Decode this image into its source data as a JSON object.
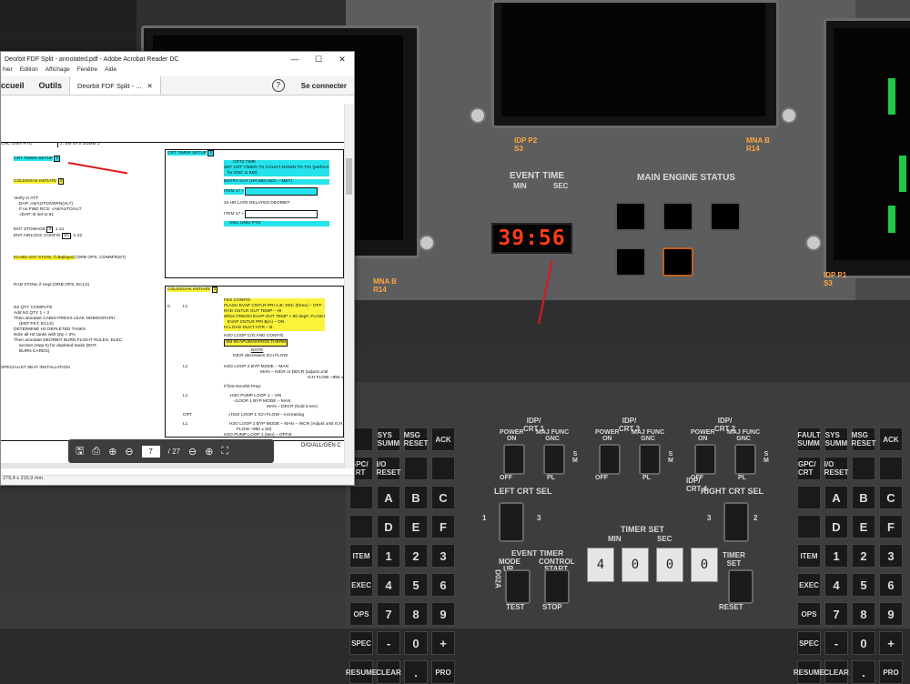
{
  "window": {
    "title": "Deorbit FDF Split - annotated.pdf - Adobe Acrobat Reader DC",
    "minimize": "—",
    "maximize": "☐",
    "close": "✕"
  },
  "menu": [
    "hier",
    "Edition",
    "Affichage",
    "Fenêtre",
    "Aide"
  ],
  "toolbar": {
    "home": "ccueil",
    "tools": "Outils",
    "tab_label": "Deorbit FDF Split - ...",
    "tab_close": "✕",
    "help": "?",
    "signin": "Se connecter"
  },
  "doc": {
    "header_left": "GNC UNIV PTG",
    "header_mid": "2: SM SYS SUMM 1",
    "crt_timer_left": "CRT TIMER SETUP",
    "crt_timer_left_num": "1",
    "coldsoak_left": "COLDSOAK INITIATE",
    "coldsoak_left_num": "2",
    "verify_lines": [
      "Verify in ATT:",
      "DAP: A5/AUTO/VERN(ALT)",
      "If no FWD RCS: √A6/AUTO/ALT",
      "√DAP: B set to 81"
    ],
    "ent_stowage": "ENT STOWAGE",
    "ent_stowage_num": "3",
    "ent_stowage_ref": ", 1-31",
    "ent_airlock": "ENT AIRLOCK CONFIG",
    "ent_airlock_num": "3A",
    "ent_airlock_ref": ", 1-32",
    "kuband": "KU-BD ANT STOW, if deployed",
    "kuband_ref": "(ORB OPS, COMM/INST)",
    "rad_stow": "RAD STOW, if reqd (ORB OPS, ECLS)",
    "n2_lines": [
      "N2 QTY COMPUTE",
      "Add N2 QTY 1 + 2",
      "Then annotate CABIN PRESS LEAK NOMOGRAPH",
      "(ENT PKT, ECLS)",
      "DETERMINE H2 DEPLETED TANKS",
      "Note all H2 tanks with Qty < 3%",
      "Then annotate DEORBIT BURN FLIGHT RULES, ELEC",
      "section (step 6) for depleted tanks (ENT,",
      "BURN CARDS)"
    ],
    "specialist": "SPECIALIST SEAT INSTALLATION",
    "crt_timer_right": "CRT TIMER SETUP",
    "crt_timer_right_num": "1",
    "crt_right_lines": [
      "CRT2 TIME",
      "SET CRT TIMER TO COUNT DOWN TO TIG (perform",
      "for GNC & SM):",
      "ENTRY DAY (HR MIN SEC – MET)",
      "ITEM 17 +",
      "24 HR LATE DELAYED DEORBIT",
      "ITEM 17 +",
      "GNC UNIV PTG"
    ],
    "coldsoak_right": "COLDSOAK INITIATE",
    "coldsoak_right_num": "2",
    "fes_c": "C",
    "fes_l1": "L1",
    "fes_lines": [
      "FES CONFIG",
      "FLASH EVAP CNTLR PRI A,B; SEC (three) – OFF",
      "RAD CNTLR OUT TEMP – HI",
      "When FREON EVAP OUT TEMP > 50 degF, FLASH",
      "EVAP CNTLR PRI B(A) – ON",
      "HI LOAD DUCT HTR – B"
    ],
    "h2o_lines": [
      "H2O LOOP C/O AND CONFIG",
      "SM 88 APU/ENVIRON THERM",
      "NOTE",
      "INCR decreases ICH FLOW"
    ],
    "l1_a": "L1",
    "h2o_byp": [
      "H2O LOOP 2 BYP MODE – MAN",
      "MAN   – INCR or DECR (adjust until",
      "ICH FLOW ~950 ± 50)"
    ],
    "if_first": "If first Deorbit Prep:",
    "l1_b": "L1",
    "pump_lines": [
      "H2O PUMP LOOP 1 – ON",
      "√LOOP 1 BYP MODE – MAN",
      "MAN   – DECR (hold 5 sec)"
    ],
    "crt_label": "CRT",
    "ich_line": "√H2O LOOP 1 ICH FLOW – increasing",
    "l1_c": "L1",
    "final_lines": [
      "H2O LOOP 1 BYP MODE – MAN – INCR (Adjust until ICH",
      "FLOW ~950 ± 50)",
      "H2O PUMP LOOP 1 (two) – OFF,B"
    ],
    "page_num": "1-7",
    "footer_code": "D/O/ALL/GEN C"
  },
  "nav": {
    "current_page": "7",
    "total": "/ 27"
  },
  "status": {
    "size": "279,4 x 215,9 mm"
  },
  "cockpit": {
    "event_time": "EVENT TIME",
    "min": "MIN",
    "sec": "SEC",
    "timer_readout": "39:56",
    "main_engine": "MAIN ENGINE STATUS",
    "idp3": "IDP P2\nS3",
    "idp1": "IDP P1\nS3",
    "mnab_left": "MNA B\nR14",
    "mnab_right": "MNA B\nR14",
    "crt_on": "ON",
    "crt_switches": [
      {
        "title": "IDP/\nCRT 1",
        "power": "POWER\nON",
        "maj": "MAJ FUNC\nGNC",
        "s": "S\nM",
        "off": "OFF",
        "pl": "PL"
      },
      {
        "title": "IDP/\nCRT 3",
        "power": "POWER\nON",
        "maj": "MAJ FUNC\nGNC",
        "s": "S\nM",
        "off": "OFF",
        "pl": "PL"
      },
      {
        "title": "IDP/\nCRT 2",
        "power": "POWER\nON",
        "maj": "MAJ FUNC\nGNC",
        "s": "S\nM",
        "off": "OFF",
        "pl": "PL"
      }
    ],
    "left_crt_sel": "LEFT CRT SEL",
    "right_crt_sel": "RIGHT CRT SEL",
    "idp_label": "IDP/\nCRT 4",
    "timer_set": "TIMER SET",
    "timer_min": "MIN",
    "timer_sec": "SEC",
    "thumbwheels": [
      "4",
      "0",
      "0",
      "0"
    ],
    "event_timer": "EVENT TIMER",
    "mode": "MODE",
    "up": "UP",
    "control": "CONTROL",
    "start": "START",
    "test": "TEST",
    "stop": "STOP",
    "timer_right": "TIMER\nSET",
    "reset": "RESET",
    "d02a": "D02A",
    "label_1": "1",
    "label_3": "3",
    "label_2": "2",
    "keypad_left": [
      "",
      "SYS SUMM",
      "MSG RESET",
      "ACK",
      "GPC/ CRT",
      "I/O RESET",
      "",
      "",
      "",
      "A",
      "B",
      "C",
      "",
      "D",
      "E",
      "F",
      "ITEM",
      "1",
      "2",
      "3",
      "EXEC",
      "4",
      "5",
      "6",
      "OPS",
      "7",
      "8",
      "9",
      "SPEC",
      "-",
      "0",
      "+",
      "RESUME",
      "CLEAR",
      ".",
      "PRO"
    ],
    "keypad_right": [
      "FAULT SUMM",
      "SYS SUMM",
      "MSG RESET",
      "ACK",
      "GPC/ CRT",
      "I/O RESET",
      "",
      "",
      "",
      "A",
      "B",
      "C",
      "",
      "D",
      "E",
      "F",
      "ITEM",
      "1",
      "2",
      "3",
      "EXEC",
      "4",
      "5",
      "6",
      "OPS",
      "7",
      "8",
      "9",
      "SPEC",
      "-",
      "0",
      "+",
      "RESUME",
      "CLEAR",
      ".",
      "PRO"
    ]
  }
}
